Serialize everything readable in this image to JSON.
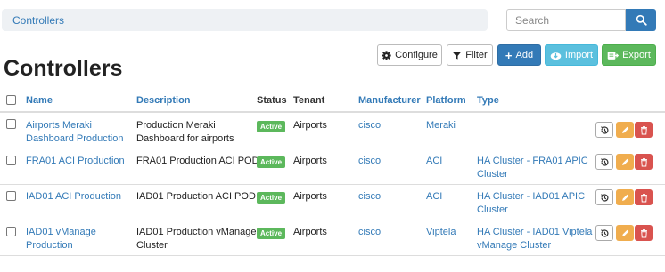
{
  "breadcrumb": {
    "label": "Controllers"
  },
  "search": {
    "placeholder": "Search",
    "icon": "search-icon"
  },
  "page_title": "Controllers",
  "toolbar": {
    "configure_label": "Configure",
    "filter_label": "Filter",
    "add_label": "Add",
    "import_label": "Import",
    "export_label": "Export"
  },
  "colors": {
    "link": "#337ab7",
    "primary": "#337ab7",
    "info": "#5bc0de",
    "success": "#5cb85c",
    "warning": "#f0ad4e",
    "danger": "#d9534f"
  },
  "table": {
    "columns": [
      "Name",
      "Description",
      "Status",
      "Tenant",
      "Manufacturer",
      "Platform",
      "Type"
    ],
    "rows": [
      {
        "name": [
          "Airports Meraki",
          "Dashboard Production"
        ],
        "description": [
          "Production Meraki",
          "Dashboard for airports"
        ],
        "status": "Active",
        "tenant": "Airports",
        "manufacturer": "cisco",
        "platform": "Meraki",
        "type": [
          "",
          ""
        ]
      },
      {
        "name": [
          "FRA01 ACI Production",
          ""
        ],
        "description": [
          "FRA01 Production ACI POD",
          ""
        ],
        "status": "Active",
        "tenant": "Airports",
        "manufacturer": "cisco",
        "platform": "ACI",
        "type": [
          "HA Cluster - FRA01 APIC",
          "Cluster"
        ]
      },
      {
        "name": [
          "IAD01 ACI Production",
          ""
        ],
        "description": [
          "IAD01 Production ACI POD",
          ""
        ],
        "status": "Active",
        "tenant": "Airports",
        "manufacturer": "cisco",
        "platform": "ACI",
        "type": [
          "HA Cluster - IAD01 APIC",
          "Cluster"
        ]
      },
      {
        "name": [
          "IAD01 vManage",
          "Production"
        ],
        "description": [
          "IAD01 Production vManage",
          "Cluster"
        ],
        "status": "Active",
        "tenant": "Airports",
        "manufacturer": "cisco",
        "platform": "Viptela",
        "type": [
          "HA Cluster - IAD01 Viptela",
          "vManage Cluster"
        ]
      }
    ]
  }
}
